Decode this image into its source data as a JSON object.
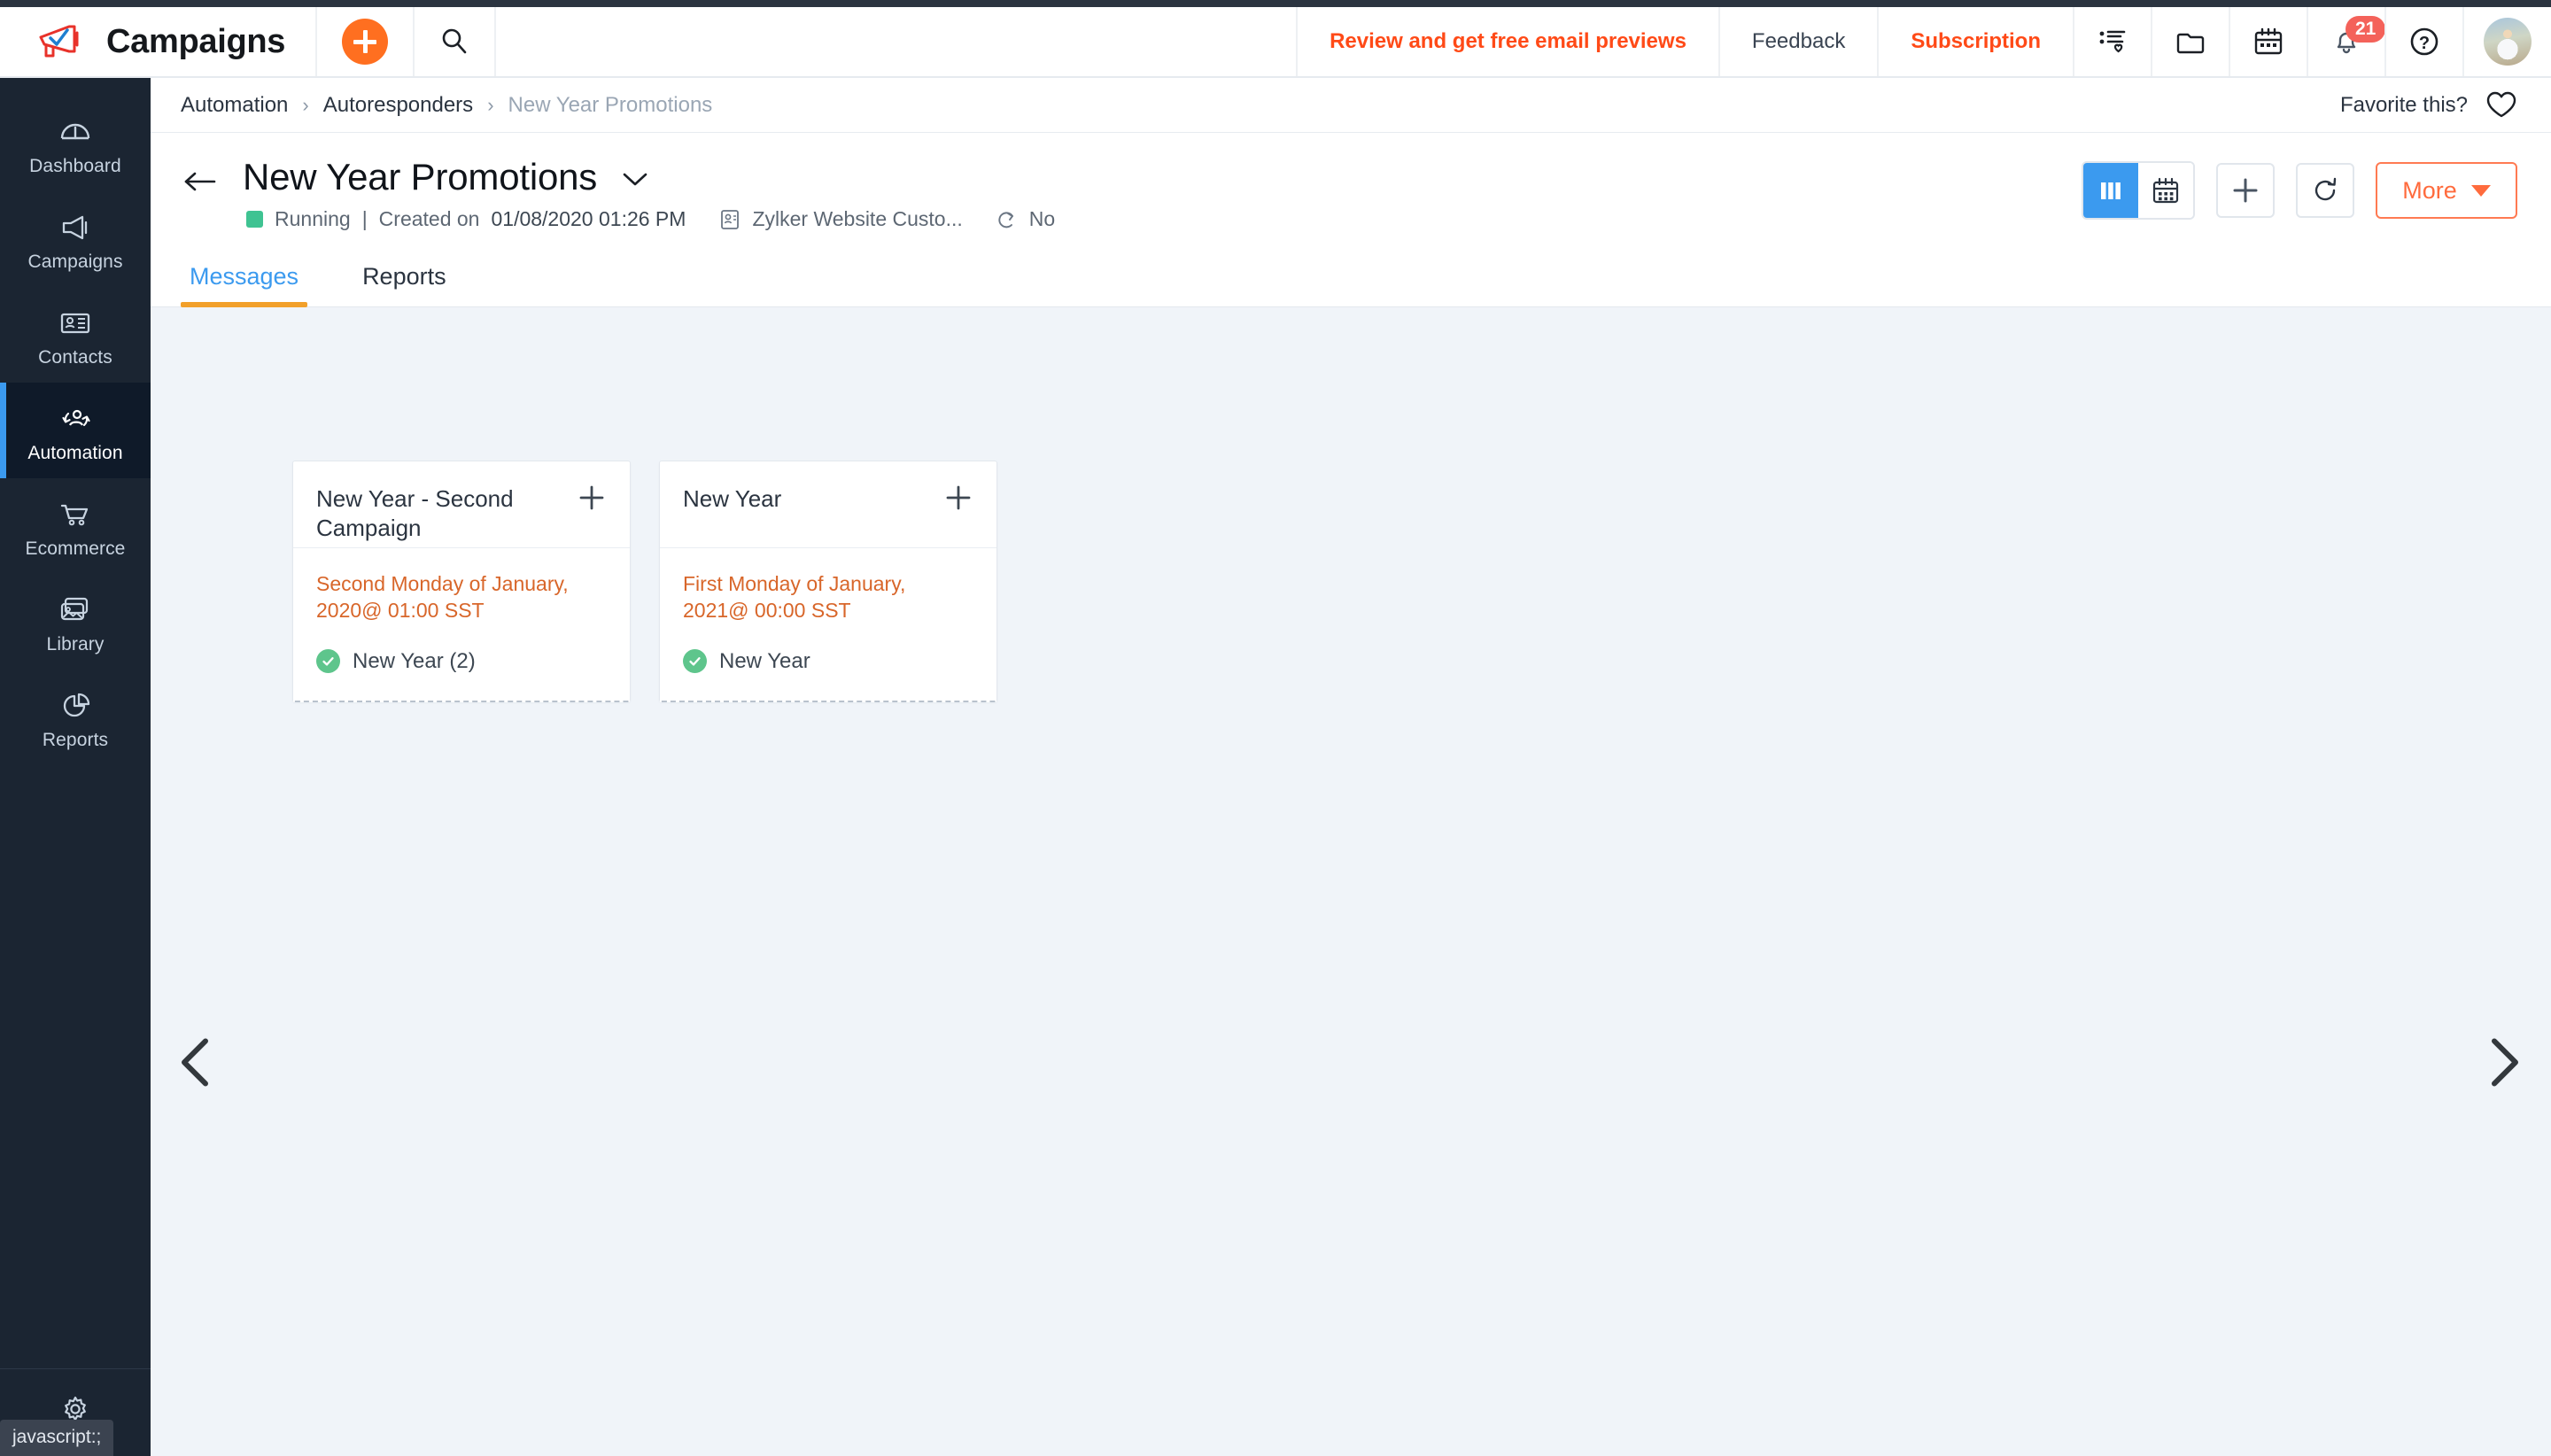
{
  "header": {
    "brand": "Campaigns",
    "logo_icon": "megaphone-check-logo",
    "create_icon": "plus-circle-icon",
    "search_icon": "search-icon",
    "links": [
      {
        "label": "Review and get free email previews",
        "style": "orange",
        "name": "review-email-previews-link"
      },
      {
        "label": "Feedback",
        "style": "gray",
        "name": "feedback-link"
      },
      {
        "label": "Subscription",
        "style": "orange",
        "name": "subscription-link"
      }
    ],
    "icons": [
      {
        "name": "list-heart-icon"
      },
      {
        "name": "folder-icon"
      },
      {
        "name": "calendar-icon"
      },
      {
        "name": "bell-icon",
        "badge": "21"
      },
      {
        "name": "help-question-icon"
      }
    ],
    "avatar": "user-avatar"
  },
  "sidebar": {
    "items": [
      {
        "label": "Dashboard",
        "icon": "dashboard-gauge-icon",
        "active": false
      },
      {
        "label": "Campaigns",
        "icon": "megaphone-icon",
        "active": false
      },
      {
        "label": "Contacts",
        "icon": "contact-card-icon",
        "active": false
      },
      {
        "label": "Automation",
        "icon": "automation-users-icon",
        "active": true
      },
      {
        "label": "Ecommerce",
        "icon": "shopping-cart-icon",
        "active": false
      },
      {
        "label": "Library",
        "icon": "image-library-icon",
        "active": false
      },
      {
        "label": "Reports",
        "icon": "pie-chart-icon",
        "active": false
      }
    ],
    "settings_icon": "gear-icon",
    "status_tooltip": "javascript:;"
  },
  "breadcrumb": {
    "items": [
      "Automation",
      "Autoresponders",
      "New Year Promotions"
    ],
    "separator": "›",
    "favorite_label": "Favorite this?",
    "favorite_icon": "heart-icon"
  },
  "page": {
    "back_icon": "back-arrow-icon",
    "title": "New Year Promotions",
    "title_caret_icon": "chevron-down-icon",
    "status": "Running",
    "status_color": "#3fc392",
    "created_label": "Created on",
    "created_date": "01/08/2020 01:26 PM",
    "separator": "|",
    "list_icon": "contact-list-icon",
    "list_name": "Zylker Website Custo...",
    "recurring_icon": "repeat-icon",
    "recurring_value": "No"
  },
  "actions": {
    "view_column_icon": "column-view-icon",
    "view_calendar_icon": "calendar-view-icon",
    "add_icon": "plus-icon",
    "refresh_icon": "refresh-icon",
    "more_label": "More",
    "more_caret_icon": "caret-down-icon"
  },
  "tabs": [
    {
      "label": "Messages",
      "active": true
    },
    {
      "label": "Reports",
      "active": false
    }
  ],
  "carousel": {
    "prev_icon": "chevron-left-icon",
    "next_icon": "chevron-right-icon"
  },
  "cards": [
    {
      "title": "New Year - Second Campaign",
      "add_icon": "plus-icon",
      "schedule": "Second Monday of January, 2020@ 01:00 SST",
      "message_status_icon": "check-circle-icon",
      "message_label": "New Year (2)"
    },
    {
      "title": "New Year",
      "add_icon": "plus-icon",
      "schedule": "First Monday of January, 2021@ 00:00 SST",
      "message_status_icon": "check-circle-icon",
      "message_label": "New Year"
    }
  ],
  "colors": {
    "accent_orange": "#ff6f20",
    "accent_blue": "#3b9aef",
    "tab_underline": "#f2a02a",
    "sidebar_bg": "#1b2532",
    "sidebar_active_bg": "#0f1a29",
    "canvas_bg": "#f0f4f9",
    "schedule_text": "#d8662a",
    "badge_red": "#f4625a",
    "status_green": "#3fc392"
  }
}
